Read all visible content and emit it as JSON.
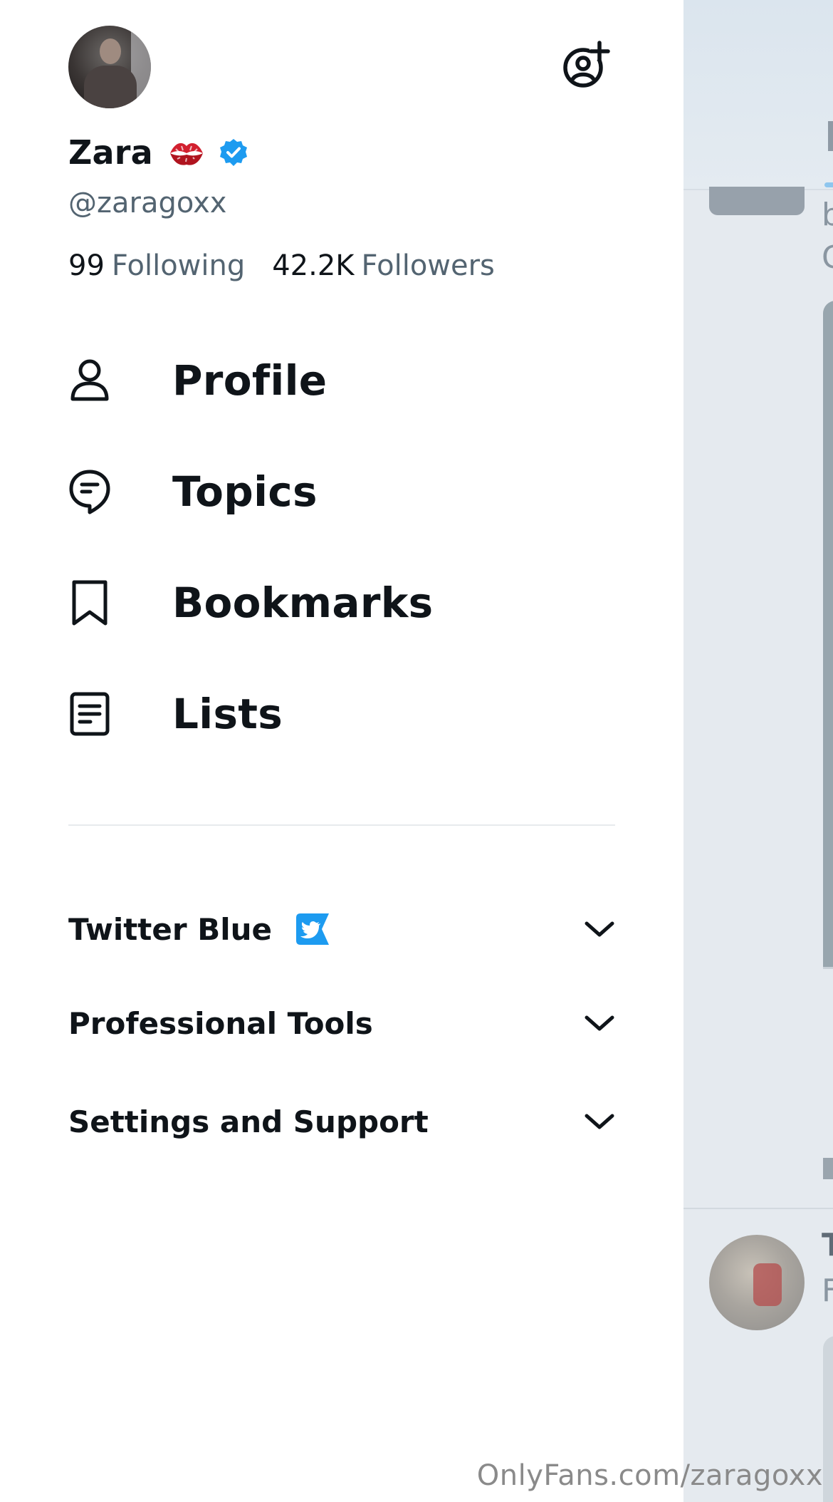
{
  "profile": {
    "display_name": "Zara",
    "handle": "@zaragoxx",
    "following_count": "99",
    "following_label": "Following",
    "followers_count": "42.2K",
    "followers_label": "Followers"
  },
  "icons": {
    "add_account": "add-account-icon",
    "kiss": "kiss-mark-emoji",
    "verified": "verified-badge-icon",
    "profile": "person-icon",
    "topics": "topics-icon",
    "bookmarks": "bookmark-icon",
    "lists": "list-icon",
    "twitter_blue": "twitter-blue-icon",
    "chevron": "chevron-down-icon"
  },
  "nav": {
    "items": [
      {
        "label": "Profile",
        "icon": "person-icon"
      },
      {
        "label": "Topics",
        "icon": "topics-icon"
      },
      {
        "label": "Bookmarks",
        "icon": "bookmark-icon"
      },
      {
        "label": "Lists",
        "icon": "list-icon"
      }
    ]
  },
  "sections": [
    {
      "label": "Twitter Blue",
      "expanded": false
    },
    {
      "label": "Professional Tools",
      "expanded": false
    },
    {
      "label": "Settings and Support",
      "expanded": false
    }
  ],
  "watermark": "OnlyFans.com/zaragoxx",
  "colors": {
    "text_primary": "#0f1419",
    "text_secondary": "#536471",
    "verified_blue": "#1d9bf0",
    "kiss_red": "#d2202f",
    "backdrop_dim": "#e5eaef"
  }
}
